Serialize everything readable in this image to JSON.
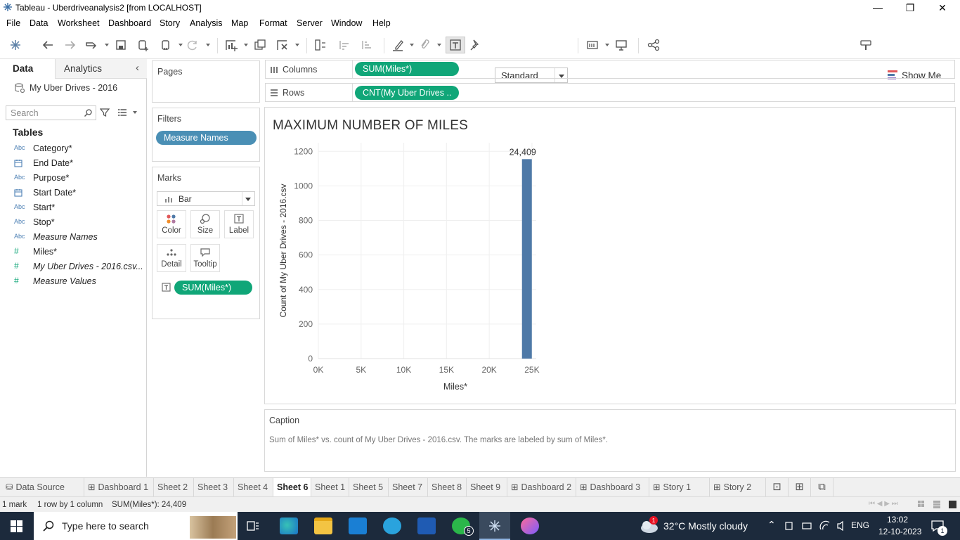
{
  "window": {
    "title": "Tableau - Uberdriveanalysis2 [from LOCALHOST]"
  },
  "menu": [
    "File",
    "Data",
    "Worksheet",
    "Dashboard",
    "Story",
    "Analysis",
    "Map",
    "Format",
    "Server",
    "Window",
    "Help"
  ],
  "toolbar": {
    "fit_select": "Standard",
    "show_me": "Show Me"
  },
  "left_pane": {
    "tab_data": "Data",
    "tab_analytics": "Analytics",
    "datasource": "My Uber Drives - 2016",
    "search_placeholder": "Search",
    "tables_heading": "Tables",
    "fields": [
      {
        "type": "Abc",
        "name": "Category*"
      },
      {
        "type": "date",
        "name": "End Date*"
      },
      {
        "type": "Abc",
        "name": "Purpose*"
      },
      {
        "type": "date",
        "name": "Start Date*"
      },
      {
        "type": "Abc",
        "name": "Start*"
      },
      {
        "type": "Abc",
        "name": "Stop*"
      },
      {
        "type": "Abc",
        "name": "Measure Names"
      },
      {
        "type": "#",
        "name": "Miles*"
      },
      {
        "type": "#",
        "name": "My Uber Drives - 2016.csv..."
      },
      {
        "type": "#",
        "name": "Measure Values"
      }
    ]
  },
  "cards": {
    "pages": "Pages",
    "filters": "Filters",
    "filter_pill": "Measure Names",
    "marks": "Marks",
    "mark_type": "Bar",
    "mark_buttons": [
      "Color",
      "Size",
      "Label",
      "Detail",
      "Tooltip"
    ],
    "label_pill": "SUM(Miles*)"
  },
  "shelves": {
    "columns_label": "Columns",
    "columns_pill": "SUM(Miles*)",
    "rows_label": "Rows",
    "rows_pill": "CNT(My Uber Drives .."
  },
  "caption": {
    "heading": "Caption",
    "text": "Sum of Miles* vs. count of My Uber Drives - 2016.csv.  The marks are labeled by sum of Miles*."
  },
  "chart_data": {
    "type": "bar",
    "title": "MAXIMUM NUMBER OF MILES",
    "xlabel": "Miles*",
    "ylabel": "Count of My Uber Drives - 2016.csv",
    "x_ticks": [
      "0K",
      "5K",
      "10K",
      "15K",
      "20K",
      "25K"
    ],
    "y_ticks": [
      "0",
      "200",
      "400",
      "600",
      "800",
      "1000",
      "1200"
    ],
    "xlim": [
      0,
      25500
    ],
    "ylim": [
      0,
      1250
    ],
    "bars": [
      {
        "x": 24409,
        "y": 1155,
        "label": "24,409"
      }
    ],
    "bar_color": "#4e79a7",
    "grid": true
  },
  "sheet_tabs": [
    {
      "label": "Data Source",
      "icon": true
    },
    {
      "label": "Dashboard 1",
      "icon": true
    },
    {
      "label": "Sheet 2"
    },
    {
      "label": "Sheet 3"
    },
    {
      "label": "Sheet 4"
    },
    {
      "label": "Sheet 6",
      "active": true
    },
    {
      "label": "Sheet 1"
    },
    {
      "label": "Sheet 5"
    },
    {
      "label": "Sheet 7"
    },
    {
      "label": "Sheet 8"
    },
    {
      "label": "Sheet 9"
    },
    {
      "label": "Dashboard 2",
      "icon": true
    },
    {
      "label": "Dashboard 3",
      "icon": true
    },
    {
      "label": "Story 1",
      "icon": true
    },
    {
      "label": "Story 2",
      "icon": true
    }
  ],
  "status": {
    "marks": "1 mark",
    "rows": "1 row by 1 column",
    "sum": "SUM(Miles*): 24,409"
  },
  "taskbar": {
    "search_placeholder": "Type here to search",
    "weather": "32°C  Mostly cloudy",
    "lang": "ENG",
    "time": "13:02",
    "date": "12-10-2023",
    "whatsapp_badge": "5",
    "weather_badge": "1",
    "notif_badge": "1"
  }
}
